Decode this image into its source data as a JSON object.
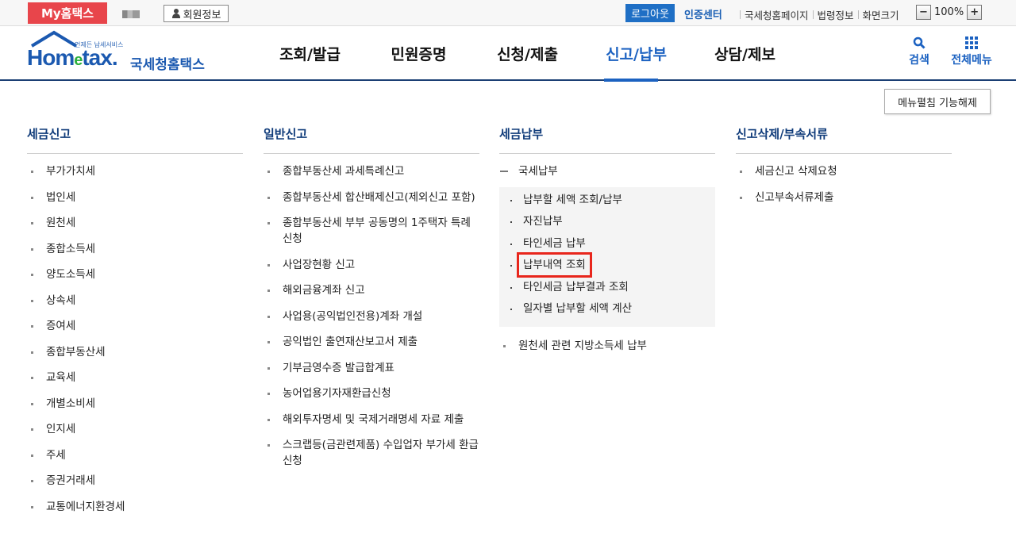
{
  "topbar": {
    "my_hometax": "My홈택스",
    "member_info": "회원정보",
    "logout": "로그아웃",
    "cert_center": "인증센터",
    "links": [
      "국세청홈페이지",
      "법령정보",
      "화면크기"
    ],
    "zoom_minus": "−",
    "zoom_level": "100%",
    "zoom_plus": "+"
  },
  "header": {
    "logo_tagline": "언제든 납세서비스",
    "logo_word_pre": "Hom",
    "logo_word_e": "e",
    "logo_word_post": "tax.",
    "logo_korean": "국세청홈택스",
    "nav_tabs": [
      "조회/발급",
      "민원증명",
      "신청/제출",
      "신고/납부",
      "상담/제보"
    ],
    "active_tab": "신고/납부",
    "search_label": "검색",
    "all_menu_label": "전체메뉴"
  },
  "menu": {
    "fold_button": "메뉴펼침 기능해제",
    "columns": [
      {
        "title": "세금신고",
        "items": [
          "부가가치세",
          "법인세",
          "원천세",
          "종합소득세",
          "양도소득세",
          "상속세",
          "증여세",
          "종합부동산세",
          "교육세",
          "개별소비세",
          "인지세",
          "주세",
          "증권거래세",
          "교통에너지환경세"
        ]
      },
      {
        "title": "일반신고",
        "items": [
          "종합부동산세 과세특례신고",
          "종합부동산세 합산배제신고(제외신고 포함)",
          "종합부동산세 부부 공동명의 1주택자 특례 신청",
          "사업장현황 신고",
          "해외금융계좌 신고",
          "사업용(공익법인전용)계좌 개설",
          "공익법인 출연재산보고서 제출",
          "기부금영수증 발급합계표",
          "농어업용기자재환급신청",
          "해외투자명세 및 국제거래명세 자료 제출",
          "스크랩등(금관련제품) 수입업자 부가세 환급 신청"
        ]
      },
      {
        "title": "세금납부",
        "expanded_item": "국세납부",
        "sub_items": [
          "납부할 세액 조회/납부",
          "자진납부",
          "타인세금 납부",
          "납부내역 조회",
          "타인세금 납부결과 조회",
          "일자별 납부할 세액 계산"
        ],
        "highlighted_sub_item": "납부내역 조회",
        "items_after": [
          "원천세 관련 지방소득세 납부"
        ]
      },
      {
        "title": "신고삭제/부속서류",
        "items": [
          "세금신고 삭제요청",
          "신고부속서류제출"
        ]
      }
    ]
  },
  "colors": {
    "brand_blue": "#1c62c1",
    "my_hometax_red": "#e8454b",
    "highlight_red": "#e8261c",
    "title_navy": "#0f3b7a"
  }
}
